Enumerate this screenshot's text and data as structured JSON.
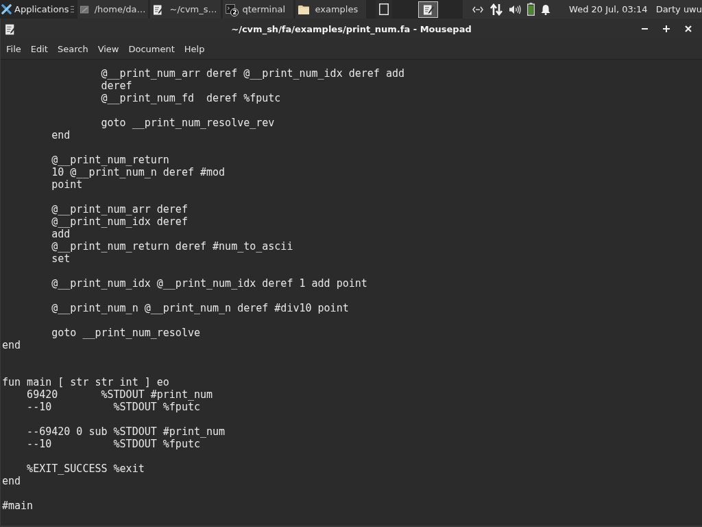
{
  "top_panel": {
    "applications_menu": "Applications",
    "tasks": [
      {
        "kind": "viewer",
        "label": "/home/da…"
      },
      {
        "kind": "editor",
        "label": "~/cvm_s…"
      },
      {
        "kind": "terminal",
        "label": "qterminal",
        "badge": "2"
      },
      {
        "kind": "file_manager",
        "label": "examples"
      }
    ],
    "clock": "Wed 20 Jul, 03:14",
    "user": "Darty uwu"
  },
  "window": {
    "title": "~/cvm_sh/fa/examples/print_num.fa - Mousepad",
    "menu": [
      "File",
      "Edit",
      "Search",
      "View",
      "Document",
      "Help"
    ]
  },
  "editor": {
    "lines": [
      {
        "kind": "code",
        "text": "                @__print_num_arr deref @__print_num_idx deref add"
      },
      {
        "kind": "code",
        "text": "                deref"
      },
      {
        "kind": "code",
        "text": "                @__print_num_fd  deref %fputc"
      },
      {
        "kind": "blank"
      },
      {
        "kind": "code",
        "text": "                goto __print_num_resolve_rev"
      },
      {
        "kind": "code",
        "text": "        end"
      },
      {
        "kind": "blank"
      },
      {
        "kind": "code",
        "text": "        @__print_num_return"
      },
      {
        "kind": "code",
        "text": "        10 @__print_num_n deref #mod"
      },
      {
        "kind": "code",
        "text": "        point"
      },
      {
        "kind": "blank"
      },
      {
        "kind": "code",
        "text": "        @__print_num_arr deref"
      },
      {
        "kind": "code",
        "text": "        @__print_num_idx deref"
      },
      {
        "kind": "code",
        "text": "        add"
      },
      {
        "kind": "code",
        "text": "        @__print_num_return deref #num_to_ascii"
      },
      {
        "kind": "code",
        "text": "        set"
      },
      {
        "kind": "blank"
      },
      {
        "kind": "code",
        "text": "        @__print_num_idx @__print_num_idx deref 1 add point"
      },
      {
        "kind": "blank"
      },
      {
        "kind": "code",
        "text": "        @__print_num_n @__print_num_n deref #div10 point"
      },
      {
        "kind": "blank"
      },
      {
        "kind": "code",
        "text": "        goto __print_num_resolve"
      },
      {
        "kind": "code",
        "text": "end"
      },
      {
        "kind": "blank"
      },
      {
        "kind": "blank"
      },
      {
        "kind": "code",
        "text": "fun main [ str str int ] eo"
      },
      {
        "kind": "code",
        "text": "    69420       %STDOUT #print_num"
      },
      {
        "kind": "code",
        "text": "    --10          %STDOUT %fputc"
      },
      {
        "kind": "blank"
      },
      {
        "kind": "code",
        "text": "    --69420 0 sub %STDOUT #print_num"
      },
      {
        "kind": "code",
        "text": "    --10          %STDOUT %fputc"
      },
      {
        "kind": "blank"
      },
      {
        "kind": "code",
        "text": "    %EXIT_SUCCESS %exit"
      },
      {
        "kind": "code",
        "text": "end"
      },
      {
        "kind": "blank"
      },
      {
        "kind": "code",
        "text": "#main"
      }
    ]
  }
}
